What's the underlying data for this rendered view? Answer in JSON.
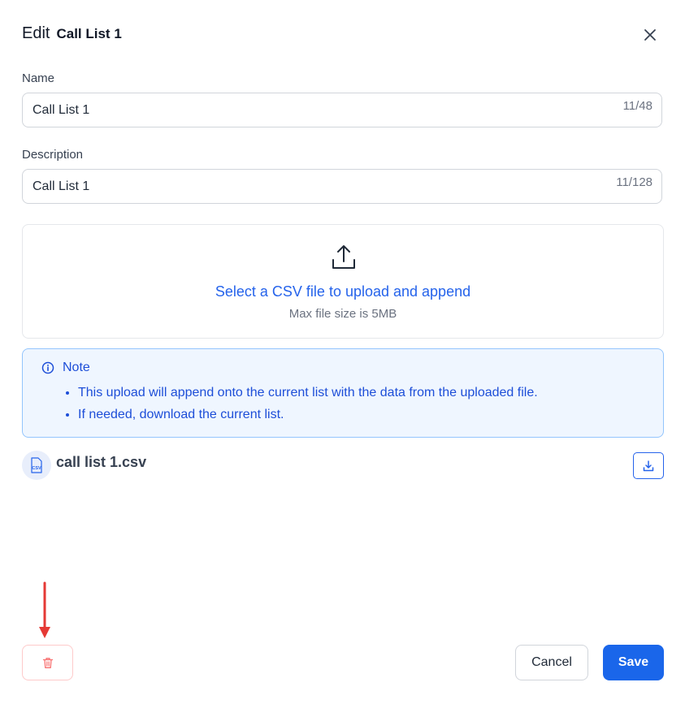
{
  "header": {
    "prefix": "Edit",
    "list_name": "Call List 1"
  },
  "icons": {
    "close": "close-icon",
    "upload": "upload-icon",
    "info": "info-icon",
    "csv": "csv-file-icon",
    "download": "download-icon",
    "trash": "trash-icon",
    "annotation_arrow": "arrow-down-icon"
  },
  "form": {
    "name": {
      "label": "Name",
      "value": "Call List 1",
      "counter": "11/48"
    },
    "description": {
      "label": "Description",
      "value": "Call List 1",
      "counter": "11/128"
    }
  },
  "upload": {
    "title": "Select a CSV file to upload and append",
    "subtitle": "Max file size is 5MB"
  },
  "note": {
    "title": "Note",
    "items": [
      "This upload will append onto the current list with the data from the uploaded file.",
      "If needed, download the current list."
    ]
  },
  "file": {
    "name": "call list 1.csv",
    "badge": "CSV"
  },
  "footer": {
    "cancel_label": "Cancel",
    "save_label": "Save"
  },
  "colors": {
    "accent": "#1a66ea",
    "link": "#2563eb",
    "note_bg": "#eff6ff",
    "note_border": "#93c5fd",
    "danger": "#f87171",
    "annotation": "#e53935"
  }
}
